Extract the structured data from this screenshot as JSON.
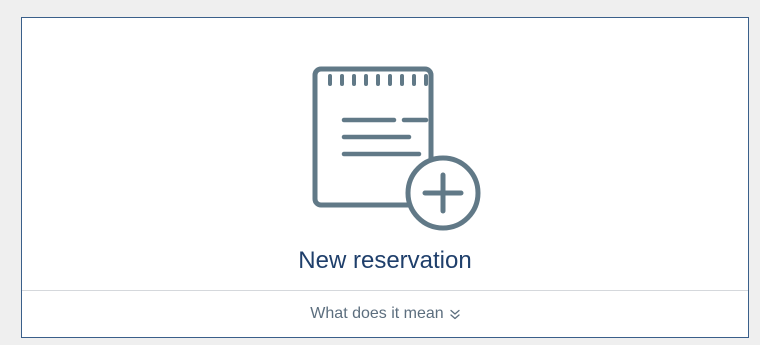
{
  "card": {
    "title": "New reservation",
    "icon": "notepad-add-icon",
    "footer_label": "What does it mean",
    "footer_icon": "double-chevron-down-icon"
  },
  "colors": {
    "page_background": "#efefef",
    "card_border": "#3a5f8a",
    "icon": "#617987",
    "title": "#1f3f6b",
    "footer_text": "#5c6e7e",
    "divider": "#d5d8dc"
  }
}
